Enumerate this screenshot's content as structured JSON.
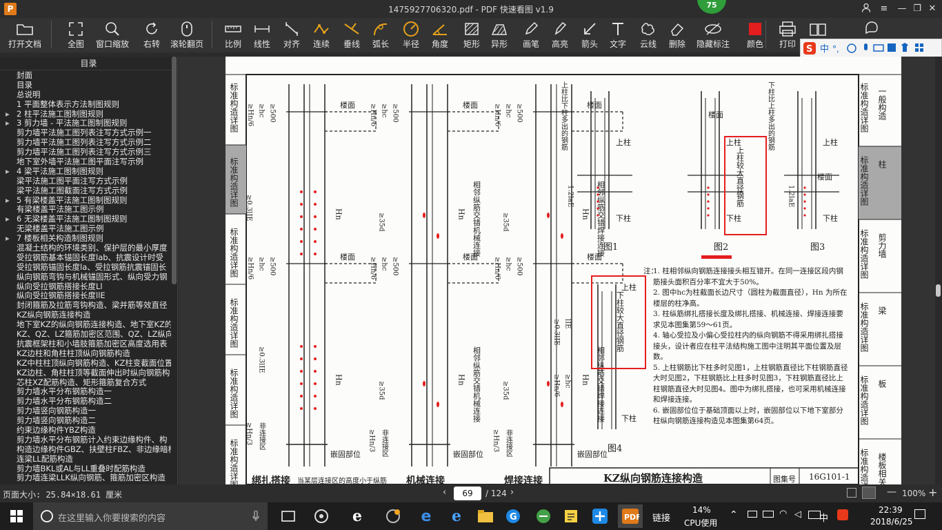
{
  "window": {
    "title": "1475927706320.pdf - PDF 快速看图 v1.9",
    "badge": "75",
    "app_icon": "P",
    "controls": [
      "user-icon",
      "menu-icon",
      "minimize-icon",
      "restore-icon",
      "close-icon"
    ]
  },
  "toolbar": {
    "tools": [
      {
        "label": "打开文档",
        "icon": "folder-icon"
      },
      {
        "label": "全图",
        "icon": "fit-icon"
      },
      {
        "label": "窗口缩放",
        "icon": "zoom-icon"
      },
      {
        "label": "右转",
        "icon": "rotate-icon"
      },
      {
        "label": "滚轮翻页",
        "icon": "mouse-icon"
      },
      {
        "label": "比例",
        "icon": "scale-icon"
      },
      {
        "label": "线性",
        "icon": "linear-icon"
      },
      {
        "label": "对齐",
        "icon": "align-icon"
      },
      {
        "label": "连续",
        "icon": "continuous-icon"
      },
      {
        "label": "垂线",
        "icon": "perpendicular-icon"
      },
      {
        "label": "弧长",
        "icon": "arc-icon"
      },
      {
        "label": "半径",
        "icon": "radius-icon"
      },
      {
        "label": "角度",
        "icon": "angle-icon"
      },
      {
        "label": "矩形",
        "icon": "rect-icon"
      },
      {
        "label": "异形",
        "icon": "polygon-icon"
      },
      {
        "label": "画笔",
        "icon": "pen-icon"
      },
      {
        "label": "高亮",
        "icon": "highlight-icon"
      },
      {
        "label": "箭头",
        "icon": "arrow-icon"
      },
      {
        "label": "文字",
        "icon": "text-icon"
      },
      {
        "label": "云线",
        "icon": "cloud-icon"
      },
      {
        "label": "删除",
        "icon": "eraser-icon"
      },
      {
        "label": "隐藏标注",
        "icon": "hide-icon"
      },
      {
        "label": "颜色",
        "icon": "color-icon"
      },
      {
        "label": "打印",
        "icon": "print-icon"
      },
      {
        "label": "帮助",
        "icon": "help-icon"
      },
      {
        "label": "",
        "icon": "chat-icon"
      }
    ],
    "accent_color": "#e6a21a",
    "color_swatch": "#e41e1e"
  },
  "ime": {
    "label": "中"
  },
  "sidebar": {
    "title": "目录",
    "items": [
      {
        "text": "封面",
        "arrow": ""
      },
      {
        "text": "目录",
        "arrow": ""
      },
      {
        "text": "总说明",
        "arrow": ""
      },
      {
        "text": "1  平面整体表示方法制图规则",
        "arrow": ""
      },
      {
        "text": "2  柱平法施工图制图规则",
        "arrow": "▸"
      },
      {
        "text": "3  剪力墙 - 平法施工图制图规则",
        "arrow": "▸"
      },
      {
        "text": "剪力墙平法施工图列表注写方式示例一",
        "arrow": ""
      },
      {
        "text": "剪力墙平法施工图列表注写方式示例二",
        "arrow": ""
      },
      {
        "text": "剪力墙平法施工图列表注写方式示例三",
        "arrow": ""
      },
      {
        "text": "地下室外墙平法施工图平面注写示例",
        "arrow": ""
      },
      {
        "text": "4  梁平法施工图制图规则",
        "arrow": "▸"
      },
      {
        "text": "梁平法施工图平面注写方式示例",
        "arrow": ""
      },
      {
        "text": "梁平法施工图截面注写方式示例",
        "arrow": ""
      },
      {
        "text": "5  有梁楼盖平法施工图制图规则",
        "arrow": "▸"
      },
      {
        "text": "有梁楼盖平法施工图示例",
        "arrow": ""
      },
      {
        "text": "6  无梁楼盖平法施工图制图规则",
        "arrow": "▸"
      },
      {
        "text": "无梁楼盖平法施工图示例",
        "arrow": ""
      },
      {
        "text": "7  楼板相关构造制图规则",
        "arrow": "▸"
      },
      {
        "text": "混凝土结构的环境类别、保护层的最小厚度",
        "arrow": ""
      },
      {
        "text": "受拉钢筋基本锚固长度lab、抗震设计时受",
        "arrow": ""
      },
      {
        "text": "受拉钢筋锚固长度la、受拉钢筋抗震锚固长",
        "arrow": ""
      },
      {
        "text": "纵向钢筋弯钩与机械锚固形式、纵向受力钢",
        "arrow": ""
      },
      {
        "text": "纵向受拉钢筋搭接长度Ll",
        "arrow": ""
      },
      {
        "text": "纵向受拉钢筋搭接长度llE",
        "arrow": ""
      },
      {
        "text": "封闭箍筋及拉筋弯钩构造、梁并筋等效直径",
        "arrow": ""
      },
      {
        "text": "KZ纵向钢筋连接构造",
        "arrow": ""
      },
      {
        "text": "地下室KZ的纵向钢筋连接构造、地下室KZ的",
        "arrow": ""
      },
      {
        "text": "KZ、QZ、LZ箍筋加密区范围、QZ、LZ纵向钢",
        "arrow": ""
      },
      {
        "text": "抗震框架柱和小墙肢箍筋加密区高度选用表",
        "arrow": ""
      },
      {
        "text": "KZ边柱和角柱柱顶纵向钢筋构造",
        "arrow": ""
      },
      {
        "text": "KZ中柱柱顶纵向钢筋构造、KZ柱变截面位置",
        "arrow": ""
      },
      {
        "text": "KZ边柱、角柱柱顶等截面伸出时纵向钢筋构",
        "arrow": ""
      },
      {
        "text": "芯柱XZ配筋构造、矩形箍筋复合方式",
        "arrow": ""
      },
      {
        "text": "剪力墙水平分布钢筋构造一",
        "arrow": ""
      },
      {
        "text": "剪力墙水平分布钢筋构造二",
        "arrow": ""
      },
      {
        "text": "剪力墙竖向钢筋构造一",
        "arrow": ""
      },
      {
        "text": "剪力墙竖向钢筋构造二",
        "arrow": ""
      },
      {
        "text": "约束边缘构件YBZ构造",
        "arrow": ""
      },
      {
        "text": "剪力墙水平分布钢筋计入约束边缘构件、构",
        "arrow": ""
      },
      {
        "text": "构造边缘构件GBZ、扶壁柱FBZ、非边缘暗柱",
        "arrow": ""
      },
      {
        "text": "连梁LL配筋构造",
        "arrow": ""
      },
      {
        "text": "剪力墙BKL或AL与LL重叠时配筋构造",
        "arrow": ""
      },
      {
        "text": "剪力墙连梁LLK纵向钢筋、箍筋加密区构造",
        "arrow": ""
      }
    ]
  },
  "document": {
    "left_strip": [
      "标准构造详图",
      "标准构造详图",
      "标准构造详图",
      "标准构造详图",
      "标准构造详图",
      "标准构造详图"
    ],
    "left_strip_top": [
      "标",
      "准",
      "一",
      "般",
      "构",
      "造"
    ],
    "right_tabs": [
      {
        "label": "标准构造详图",
        "side": "一般构造"
      },
      {
        "label": "标准构造详图",
        "side": "柱"
      },
      {
        "label": "标准构造详图",
        "side": "剪力墙"
      },
      {
        "label": "标准构造详图",
        "side": "梁"
      },
      {
        "label": "标准构造详图",
        "side": "板"
      },
      {
        "label": "标准构造详图",
        "side": "楼板相关"
      }
    ],
    "diagram_labels": {
      "floor": "楼面",
      "upper_col": "上柱",
      "lower_col": "下柱",
      "embed": "嵌固部位",
      "non_connect": "非连接区",
      "mech_text": "相邻纵筋交错机械连接",
      "weld_text": "相邻纵筋交错焊接连接",
      "dim_hn6": "≥Hn/6",
      "dim_hc": "≥hc",
      "dim_500": "≥500",
      "dim_035": "≥0.3lIE",
      "dim_lle": "lIE",
      "dim_35d": "≥35d",
      "dim_hn3": "≥Hn/3",
      "hn": "Hn",
      "fig1": "图1",
      "fig2": "图2",
      "fig3": "图3",
      "fig4": "图4",
      "fig1_note": "上柱比下柱多出的钢筋",
      "fig3_note": "下柱比上柱多出的钢筋",
      "fig2_box": "上柱较大直径钢筋",
      "fig4_box": "下柱较大直径钢筋",
      "l12": "1.2laE"
    },
    "bottom_labels": [
      "绑扎搭接",
      "当某层连接区的高度小于纵筋",
      "机械连接",
      "焊接连接"
    ],
    "title_block": {
      "title": "KZ纵向钢筋连接构造",
      "atlas_label": "图集号",
      "atlas_no": "16G101-1"
    },
    "notes_title": "注：",
    "notes": [
      "1. 柱相邻纵向钢筋连接接头相互错开。在同一连接区段内钢筋接头面积百分率不宜大于50%。",
      "2. 图中hc为柱截面长边尺寸（圆柱为截面直径），Hn 为所在楼层的柱净高。",
      "3. 柱纵筋绑扎搭接长度及绑扎搭接、机械连接、焊接连接要求见本图集第59～61页。",
      "4. 轴心受拉及小偏心受拉柱内的纵向钢筋不得采用绑扎搭接接头，设计者应在柱平法结构施工图中注明其平面位置及层数。",
      "5. 上柱钢筋比下柱多时见图1，上柱钢筋直径比下柱钢筋直径大时见图2，下柱钢筋比上柱多时见图3，下柱钢筋直径比上柱钢筋直径大时见图4。图中为绑扎搭接，也可采用机械连接和焊接连接。",
      "6. 嵌固部位位于基础顶面以上时，嵌固部位以下地下室部分柱纵向钢筋连接构造见本图集第64页。"
    ]
  },
  "status": {
    "page_size": "页面大小: 25.84×18.61 厘米",
    "current_page": "69",
    "total_pages": "/ 124",
    "zoom": "100%"
  },
  "taskbar": {
    "search_placeholder": "在这里输入你要搜索的内容",
    "link_label": "链接",
    "cpu_percent": "14%",
    "cpu_label": "CPU使用",
    "ime": "中",
    "time": "22:39",
    "date": "2018/6/25"
  }
}
